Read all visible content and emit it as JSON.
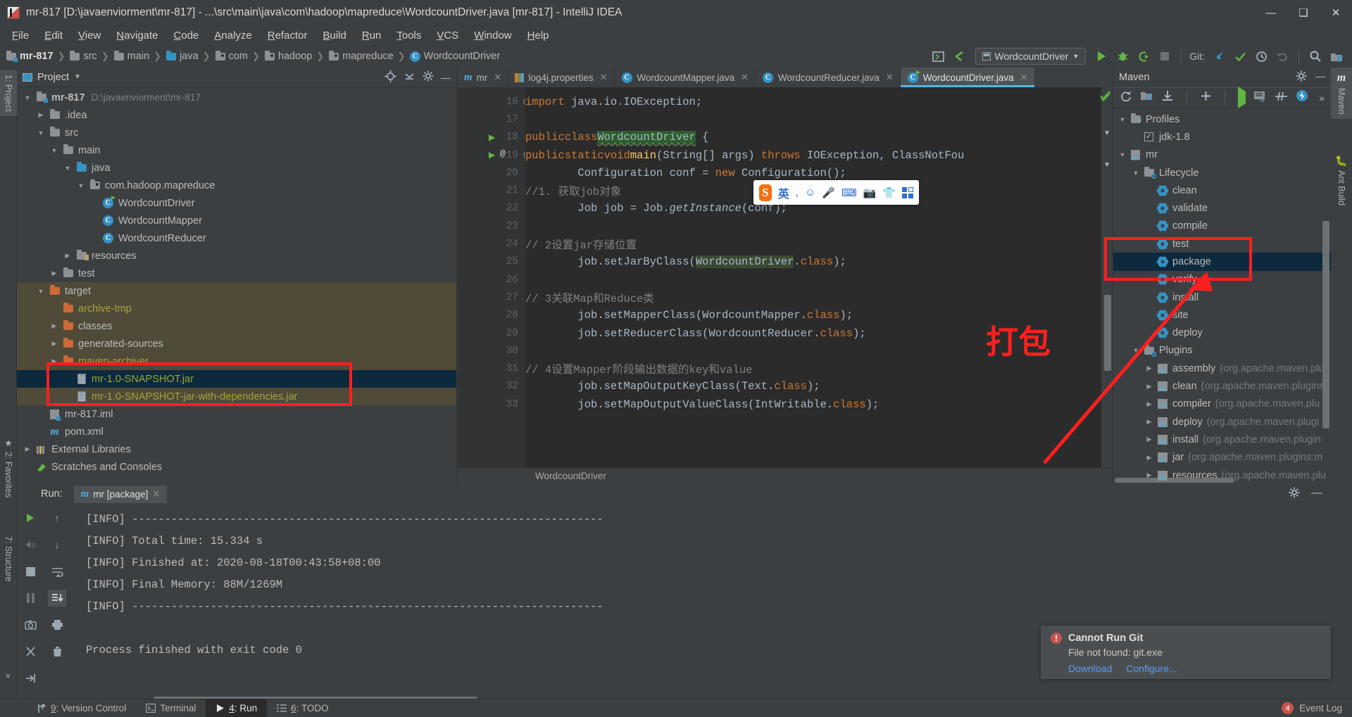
{
  "window": {
    "title": "mr-817 [D:\\javaenviorment\\mr-817] - ...\\src\\main\\java\\com\\hadoop\\mapreduce\\WordcountDriver.java [mr-817] - IntelliJ IDEA",
    "minimize": "—",
    "maximize": "❑",
    "close": "✕"
  },
  "menu": [
    "File",
    "Edit",
    "View",
    "Navigate",
    "Code",
    "Analyze",
    "Refactor",
    "Build",
    "Run",
    "Tools",
    "VCS",
    "Window",
    "Help"
  ],
  "breadcrumb": [
    {
      "label": "mr-817",
      "icon": "module-folder-icon",
      "bold": true
    },
    {
      "label": "src",
      "icon": "folder-icon"
    },
    {
      "label": "main",
      "icon": "folder-icon"
    },
    {
      "label": "java",
      "icon": "source-folder-icon"
    },
    {
      "label": "com",
      "icon": "package-icon"
    },
    {
      "label": "hadoop",
      "icon": "package-icon"
    },
    {
      "label": "mapreduce",
      "icon": "package-icon"
    },
    {
      "label": "WordcountDriver",
      "icon": "java-class-icon"
    }
  ],
  "toolbar": {
    "run_config": "WordcountDriver",
    "git_label": "Git:",
    "buttons": [
      "open-tool-window",
      "back-arrow",
      "run",
      "debug",
      "run-coverage",
      "stop",
      "git-update",
      "git-commit",
      "git-history",
      "git-rollback",
      "search",
      "project-structure"
    ]
  },
  "left_strips": [
    {
      "label": "1: Project",
      "key": "1",
      "selected": true
    },
    {
      "label": "2: Favorites",
      "key": "2",
      "selected": false
    },
    {
      "label": "7: Structure",
      "key": "7",
      "selected": false
    }
  ],
  "right_strips": [
    {
      "label": "Maven",
      "selected": true
    },
    {
      "label": "Ant Build",
      "selected": false
    }
  ],
  "project_panel": {
    "title": "Project",
    "tree": [
      {
        "indent": 0,
        "arrow": "down",
        "icon": "module-folder-icon",
        "label": "mr-817",
        "sub": "D:\\javaenviorment\\mr-817",
        "bold": true
      },
      {
        "indent": 1,
        "arrow": "right",
        "icon": "folder-icon",
        "label": ".idea"
      },
      {
        "indent": 1,
        "arrow": "down",
        "icon": "folder-icon",
        "label": "src"
      },
      {
        "indent": 2,
        "arrow": "down",
        "icon": "folder-icon",
        "label": "main"
      },
      {
        "indent": 3,
        "arrow": "down",
        "icon": "source-folder-icon",
        "label": "java"
      },
      {
        "indent": 4,
        "arrow": "down",
        "icon": "package-icon",
        "label": "com.hadoop.mapreduce"
      },
      {
        "indent": 5,
        "arrow": "none",
        "icon": "java-class-runnable-icon",
        "label": "WordcountDriver"
      },
      {
        "indent": 5,
        "arrow": "none",
        "icon": "java-class-icon",
        "label": "WordcountMapper"
      },
      {
        "indent": 5,
        "arrow": "none",
        "icon": "java-class-icon",
        "label": "WordcountReducer"
      },
      {
        "indent": 3,
        "arrow": "right",
        "icon": "resources-folder-icon",
        "label": "resources"
      },
      {
        "indent": 2,
        "arrow": "right",
        "icon": "folder-icon",
        "label": "test"
      },
      {
        "indent": 1,
        "arrow": "down",
        "icon": "excluded-folder-icon",
        "label": "target",
        "row_bg": "target"
      },
      {
        "indent": 2,
        "arrow": "none",
        "icon": "excluded-folder-icon",
        "label": "archive-tmp",
        "row_bg": "target",
        "text_color": "yellow"
      },
      {
        "indent": 2,
        "arrow": "right",
        "icon": "excluded-folder-icon",
        "label": "classes",
        "row_bg": "target"
      },
      {
        "indent": 2,
        "arrow": "right",
        "icon": "excluded-folder-icon",
        "label": "generated-sources",
        "row_bg": "target"
      },
      {
        "indent": 2,
        "arrow": "right",
        "icon": "excluded-folder-icon",
        "label": "maven-archiver",
        "row_bg": "target",
        "text_color": "yellow"
      },
      {
        "indent": 3,
        "arrow": "none",
        "icon": "jar-icon",
        "label": "mr-1.0-SNAPSHOT.jar",
        "selected": true,
        "text_color": "green"
      },
      {
        "indent": 3,
        "arrow": "none",
        "icon": "jar-icon",
        "label": "mr-1.0-SNAPSHOT-jar-with-dependencies.jar",
        "row_bg": "target",
        "text_color": "yellow"
      },
      {
        "indent": 1,
        "arrow": "none",
        "icon": "iml-icon",
        "label": "mr-817.iml"
      },
      {
        "indent": 1,
        "arrow": "none",
        "icon": "maven-pom-icon",
        "label": "pom.xml"
      },
      {
        "indent": 0,
        "arrow": "right",
        "icon": "libraries-icon",
        "label": "External Libraries"
      },
      {
        "indent": 0,
        "arrow": "none",
        "icon": "scratches-icon",
        "label": "Scratches and Consoles"
      }
    ]
  },
  "editor": {
    "tabs": [
      {
        "label": "mr",
        "icon": "maven-icon",
        "active": false
      },
      {
        "label": "log4j.properties",
        "icon": "properties-icon",
        "active": false
      },
      {
        "label": "WordcountMapper.java",
        "icon": "java-class-icon",
        "active": false
      },
      {
        "label": "WordcountReducer.java",
        "icon": "java-class-icon",
        "active": false
      },
      {
        "label": "WordcountDriver.java",
        "icon": "java-class-runnable-icon",
        "active": true
      }
    ],
    "first_line_number": 16,
    "lines": [
      {
        "n": 16,
        "html": "<span class='kw'>import</span> java.io.IOException;",
        "fold": true
      },
      {
        "n": 17,
        "html": ""
      },
      {
        "n": 18,
        "html": "<span class='kw'>public</span> <span class='kw'>class</span> <span class='hl-green squiggle'>WordcountDriver</span> {",
        "run_marker": true
      },
      {
        "n": 19,
        "html": "    <span class='kw'>public</span> <span class='kw'>static</span> <span class='kw'>void</span> <span class='mth'>main</span>(String[] args) <span class='kw'>throws</span> IOException, ClassNotFou",
        "run_marker": true,
        "at_marker": true,
        "fold": true
      },
      {
        "n": 20,
        "html": "        Configuration conf = <span class='kw'>new</span> Configuration();"
      },
      {
        "n": 21,
        "html": "        <span class='cm'>//1. 获取job对象</span>"
      },
      {
        "n": 22,
        "html": "        Job job = Job.<span class='fn-it'>getInstance</span>(conf);"
      },
      {
        "n": 23,
        "html": ""
      },
      {
        "n": 24,
        "html": "        <span class='cm'>// 2设置jar存储位置</span>"
      },
      {
        "n": 25,
        "html": "        job.setJarByClass(<span class='hl-green-dim'>WordcountDriver</span>.<span class='kw'>class</span>);"
      },
      {
        "n": 26,
        "html": ""
      },
      {
        "n": 27,
        "html": "        <span class='cm'>// 3关联Map和Reduce类</span>"
      },
      {
        "n": 28,
        "html": "        job.setMapperClass(WordcountMapper.<span class='kw'>class</span>);"
      },
      {
        "n": 29,
        "html": "        job.setReducerClass(WordcountReducer.<span class='kw'>class</span>);"
      },
      {
        "n": 30,
        "html": ""
      },
      {
        "n": 31,
        "html": "        <span class='cm'>// 4设置Mapper阶段输出数据的key和value</span>"
      },
      {
        "n": 32,
        "html": "        job.setMapOutputKeyClass(Text.<span class='kw'>class</span>);"
      },
      {
        "n": 33,
        "html": "        job.setMapOutputValueClass(IntWritable.<span class='kw'>class</span>);"
      }
    ],
    "status_breadcrumb": "WordcountDriver"
  },
  "maven": {
    "title": "Maven",
    "toolbar_buttons": [
      "reimport",
      "generate-sources",
      "download-sources",
      "add-maven-project",
      "run-maven-build",
      "execute-maven-goal",
      "toggle-skip-tests",
      "toggle-offline",
      "more"
    ],
    "tree": [
      {
        "indent": 0,
        "arrow": "down",
        "icon": "profiles-folder-icon",
        "label": "Profiles"
      },
      {
        "indent": 1,
        "arrow": "none",
        "icon": "checkbox-icon",
        "label": "jdk-1.8",
        "checked": true
      },
      {
        "indent": 0,
        "arrow": "down",
        "icon": "maven-project-icon",
        "label": "mr"
      },
      {
        "indent": 1,
        "arrow": "down",
        "icon": "lifecycle-folder-icon",
        "label": "Lifecycle"
      },
      {
        "indent": 2,
        "arrow": "none",
        "icon": "goal-icon",
        "label": "clean"
      },
      {
        "indent": 2,
        "arrow": "none",
        "icon": "goal-icon",
        "label": "validate"
      },
      {
        "indent": 2,
        "arrow": "none",
        "icon": "goal-icon",
        "label": "compile"
      },
      {
        "indent": 2,
        "arrow": "none",
        "icon": "goal-icon",
        "label": "test"
      },
      {
        "indent": 2,
        "arrow": "none",
        "icon": "goal-icon",
        "label": "package",
        "selected": true
      },
      {
        "indent": 2,
        "arrow": "none",
        "icon": "goal-icon",
        "label": "verify"
      },
      {
        "indent": 2,
        "arrow": "none",
        "icon": "goal-icon",
        "label": "install"
      },
      {
        "indent": 2,
        "arrow": "none",
        "icon": "goal-icon",
        "label": "site"
      },
      {
        "indent": 2,
        "arrow": "none",
        "icon": "goal-icon",
        "label": "deploy"
      },
      {
        "indent": 1,
        "arrow": "down",
        "icon": "plugins-folder-icon",
        "label": "Plugins"
      },
      {
        "indent": 2,
        "arrow": "right",
        "icon": "maven-plugin-icon",
        "label": "assembly",
        "sub": "(org.apache.maven.plu"
      },
      {
        "indent": 2,
        "arrow": "right",
        "icon": "maven-plugin-icon",
        "label": "clean",
        "sub": "(org.apache.maven.plugins"
      },
      {
        "indent": 2,
        "arrow": "right",
        "icon": "maven-plugin-icon",
        "label": "compiler",
        "sub": "(org.apache.maven.plu"
      },
      {
        "indent": 2,
        "arrow": "right",
        "icon": "maven-plugin-icon",
        "label": "deploy",
        "sub": "(org.apache.maven.plugi"
      },
      {
        "indent": 2,
        "arrow": "right",
        "icon": "maven-plugin-icon",
        "label": "install",
        "sub": "(org.apache.maven.plugin"
      },
      {
        "indent": 2,
        "arrow": "right",
        "icon": "maven-plugin-icon",
        "label": "jar",
        "sub": "(org.apache.maven.plugins:m"
      },
      {
        "indent": 2,
        "arrow": "right",
        "icon": "maven-plugin-icon",
        "label": "resources",
        "sub": "(org.apache.maven.plu"
      }
    ]
  },
  "run_panel": {
    "label": "Run:",
    "tab": "mr [package]",
    "sidebar_buttons": [
      "rerun",
      "rerun-failed",
      "stop",
      "pause",
      "camera",
      "stacktrace",
      "export"
    ],
    "sidebar2_buttons": [
      "up-stack",
      "down-stack",
      "soft-wrap",
      "scroll-to-end",
      "print",
      "clear-all"
    ],
    "console": [
      "[INFO] ------------------------------------------------------------------------",
      "[INFO] Total time: 15.334 s",
      "[INFO] Finished at: 2020-08-18T00:43:58+08:00",
      "[INFO] Final Memory: 88M/1269M",
      "[INFO] ------------------------------------------------------------------------",
      "",
      "Process finished with exit code 0"
    ]
  },
  "notification": {
    "title": "Cannot Run Git",
    "body": "File not found: git.exe",
    "links": [
      "Download",
      "Configure..."
    ]
  },
  "status_bar": {
    "items": [
      {
        "label": "9: Version Control",
        "key": "9",
        "icon": "vcs-icon",
        "selected": false
      },
      {
        "label": "Terminal",
        "key": "",
        "icon": "terminal-icon",
        "selected": false
      },
      {
        "label": "4: Run",
        "key": "4",
        "icon": "run-icon",
        "selected": true
      },
      {
        "label": "6: TODO",
        "key": "6",
        "icon": "todo-icon",
        "selected": false
      }
    ],
    "event_log": "Event Log",
    "event_count": "4"
  },
  "ime_bar": {
    "logo": "S",
    "mode": "英",
    "icons": [
      "punctuation-icon",
      "emoji-icon",
      "voice-input-icon",
      "soft-keyboard-icon",
      "screenshot-icon",
      "skin-icon",
      "toolbox-icon"
    ]
  },
  "annotations": {
    "package_label": "打包"
  },
  "colors": {
    "accent": "#3592c4",
    "selection": "#0d293e",
    "annotation_red": "#ff1f1f",
    "error_red": "#c75450",
    "run_green": "#62b543",
    "keyword_orange": "#cc7832",
    "string_green": "#6a8759",
    "link_blue": "#589df6"
  }
}
